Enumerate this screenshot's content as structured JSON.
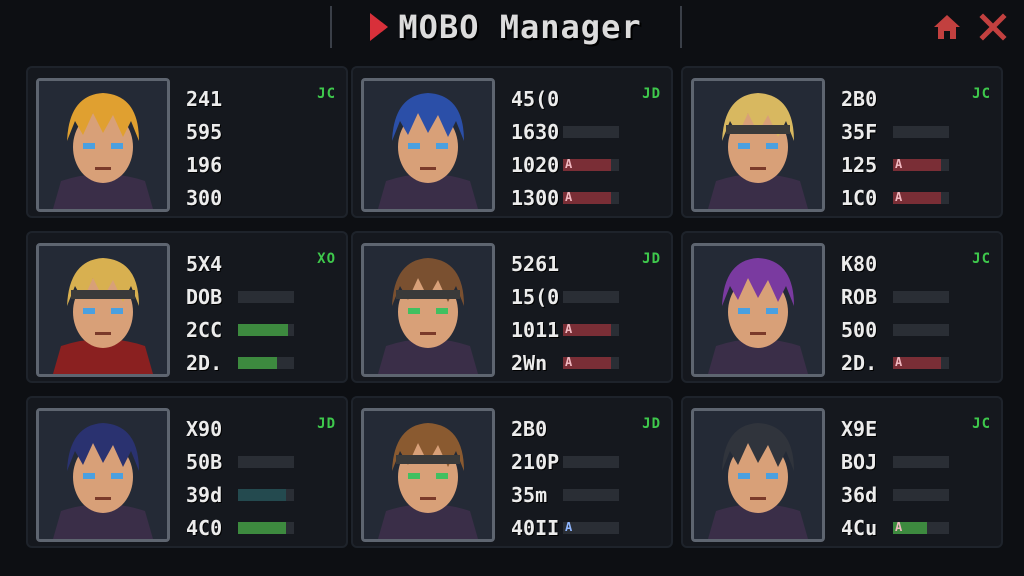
{
  "header": {
    "title": "MOBO Manager",
    "home_icon": "home-icon",
    "close_icon": "close-icon"
  },
  "colors": {
    "accent_red": "#d8303a",
    "badge_green": "#3ec84c",
    "bar_green": "#3d8a3f",
    "bar_red": "#7a2e36"
  },
  "cards": [
    {
      "name": "card-1",
      "badge": "JC",
      "stats": [
        "241",
        "595",
        "196",
        "300"
      ],
      "bars": [
        null,
        null,
        null,
        null
      ],
      "portrait": "hero-blonde-spiky"
    },
    {
      "name": "card-2",
      "badge": "JD",
      "stats": [
        "45(0",
        "1630",
        "1020",
        "1300"
      ],
      "bars": [
        null,
        {
          "fill": 0.0,
          "tag": ""
        },
        {
          "fill": 0.85,
          "tag": "A",
          "color": "red"
        },
        {
          "fill": 0.85,
          "tag": "A",
          "color": "red"
        }
      ],
      "portrait": "hero-blue-hair"
    },
    {
      "name": "card-3",
      "badge": "JC",
      "stats": [
        "2B0",
        "35F",
        "125",
        "1C0"
      ],
      "bars": [
        null,
        {
          "fill": 0.0,
          "tag": ""
        },
        {
          "fill": 0.85,
          "tag": "A",
          "color": "red"
        },
        {
          "fill": 0.85,
          "tag": "A",
          "color": "red"
        }
      ],
      "portrait": "hero-headband-blonde"
    },
    {
      "name": "card-4",
      "badge": "XO",
      "stats": [
        "5X4",
        "DOB",
        "2CC",
        "2D."
      ],
      "bars": [
        null,
        {
          "fill": 0.0,
          "tag": ""
        },
        {
          "fill": 0.9,
          "tag": "",
          "color": "green"
        },
        {
          "fill": 0.7,
          "tag": "",
          "color": "green"
        }
      ],
      "portrait": "hero-ninja-blonde"
    },
    {
      "name": "card-5",
      "badge": "JD",
      "stats": [
        "5261",
        "15(0",
        "1011",
        "2Wn"
      ],
      "bars": [
        null,
        {
          "fill": 0.0,
          "tag": ""
        },
        {
          "fill": 0.85,
          "tag": "A",
          "color": "red"
        },
        {
          "fill": 0.85,
          "tag": "A",
          "color": "red"
        }
      ],
      "portrait": "hero-brown-hair"
    },
    {
      "name": "card-6",
      "badge": "JC",
      "stats": [
        "K80",
        "ROB",
        "500",
        "2D."
      ],
      "bars": [
        null,
        {
          "fill": 0.0,
          "tag": ""
        },
        {
          "fill": 0.0,
          "tag": ""
        },
        {
          "fill": 0.85,
          "tag": "A",
          "color": "red"
        }
      ],
      "portrait": "hero-purple-hair"
    },
    {
      "name": "card-7",
      "badge": "JD",
      "stats": [
        "X90",
        "50B",
        "39d",
        "4C0"
      ],
      "bars": [
        null,
        {
          "fill": 0.0,
          "tag": ""
        },
        {
          "fill": 0.85,
          "tag": "",
          "color": "teal"
        },
        {
          "fill": 0.85,
          "tag": "",
          "color": "green"
        }
      ],
      "portrait": "hero-dark-blue"
    },
    {
      "name": "card-8",
      "badge": "JD",
      "stats": [
        "2B0",
        "210P",
        "35m",
        "40II"
      ],
      "bars": [
        null,
        {
          "fill": 0.0,
          "tag": ""
        },
        {
          "fill": 0.0,
          "tag": ""
        },
        {
          "fill": 0.0,
          "tag": "A",
          "color": "blue"
        }
      ],
      "portrait": "hero-brown-headband"
    },
    {
      "name": "card-9",
      "badge": "JC",
      "stats": [
        "X9E",
        "BOJ",
        "36d",
        "4Cu"
      ],
      "bars": [
        null,
        {
          "fill": 0.0,
          "tag": ""
        },
        {
          "fill": 0.0,
          "tag": ""
        },
        {
          "fill": 0.6,
          "tag": "A",
          "color": "green"
        }
      ],
      "portrait": "hero-hooded"
    }
  ]
}
